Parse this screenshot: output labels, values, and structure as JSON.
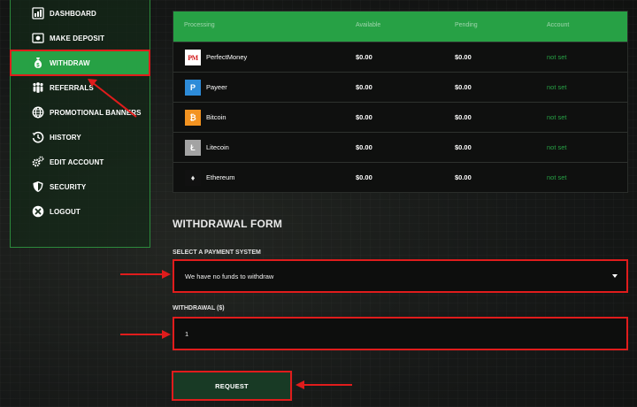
{
  "sidebar": {
    "items": [
      {
        "label": "DASHBOARD",
        "icon": "dashboard-icon",
        "active": false
      },
      {
        "label": "MAKE DEPOSIT",
        "icon": "money-icon",
        "active": false
      },
      {
        "label": "WITHDRAW",
        "icon": "money-bag-icon",
        "active": true
      },
      {
        "label": "REFERRALS",
        "icon": "users-icon",
        "active": false
      },
      {
        "label": "PROMOTIONAL BANNERS",
        "icon": "globe-icon",
        "active": false
      },
      {
        "label": "HISTORY",
        "icon": "history-icon",
        "active": false
      },
      {
        "label": "EDIT ACCOUNT",
        "icon": "gears-icon",
        "active": false
      },
      {
        "label": "SECURITY",
        "icon": "shield-icon",
        "active": false
      },
      {
        "label": "LOGOUT",
        "icon": "close-circle-icon",
        "active": false
      }
    ]
  },
  "table": {
    "headers": {
      "processing": "Processing",
      "available": "Available",
      "pending": "Pending",
      "account": "Account"
    },
    "rows": [
      {
        "logo": "PM",
        "logo_icon": "perfectmoney-logo-icon",
        "logo_bg": "#ffffff",
        "logo_fg": "#d3191b",
        "name": "PerfectMoney",
        "available": "$0.00",
        "pending": "$0.00",
        "account": "not set"
      },
      {
        "logo": "P",
        "logo_icon": "payeer-logo-icon",
        "logo_bg": "#2d8bd8",
        "logo_fg": "#ffffff",
        "name": "Payeer",
        "available": "$0.00",
        "pending": "$0.00",
        "account": "not set"
      },
      {
        "logo": "₿",
        "logo_icon": "bitcoin-logo-icon",
        "logo_bg": "#f39321",
        "logo_fg": "#ffffff",
        "name": "Bitcoin",
        "available": "$0.00",
        "pending": "$0.00",
        "account": "not set"
      },
      {
        "logo": "Ł",
        "logo_icon": "litecoin-logo-icon",
        "logo_bg": "#a3a3a3",
        "logo_fg": "#ffffff",
        "name": "Litecoin",
        "available": "$0.00",
        "pending": "$0.00",
        "account": "not set"
      },
      {
        "logo": "♦",
        "logo_icon": "ethereum-logo-icon",
        "logo_bg": "#111111",
        "logo_fg": "#e6e6e6",
        "name": "Ethereum",
        "available": "$0.00",
        "pending": "$0.00",
        "account": "not set"
      }
    ]
  },
  "form": {
    "title": "WITHDRAWAL FORM",
    "payment_label": "SELECT A PAYMENT SYSTEM",
    "payment_value": "We have no funds to withdraw",
    "amount_label": "WITHDRAWAL ($)",
    "amount_value": "1",
    "request_label": "REQUEST"
  },
  "colors": {
    "accent": "#27a145",
    "highlight": "#e01c1c",
    "background": "#161817"
  }
}
